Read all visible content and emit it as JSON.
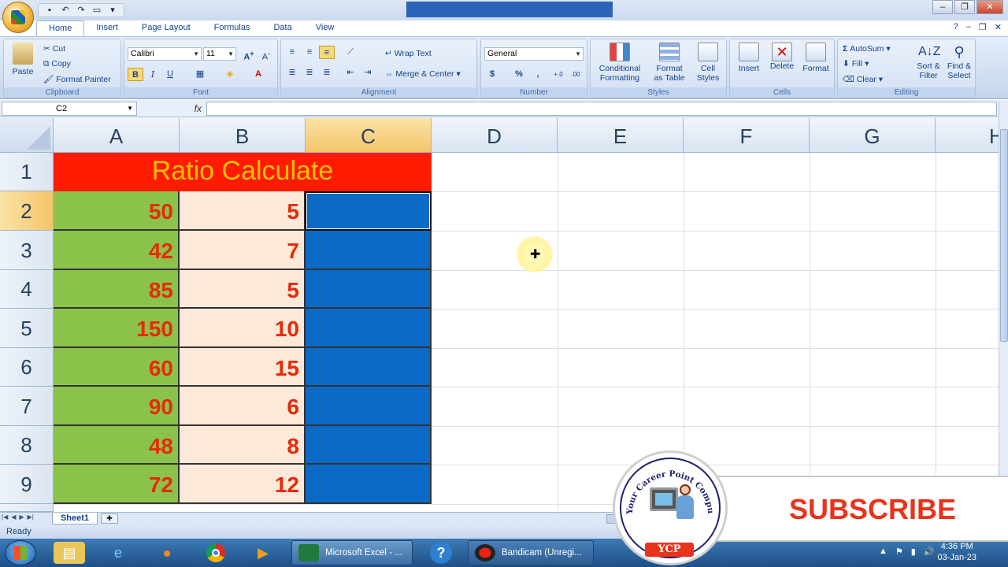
{
  "app": {
    "tabs": [
      "Home",
      "Insert",
      "Page Layout",
      "Formulas",
      "Data",
      "View"
    ],
    "active_tab": "Home"
  },
  "ribbon": {
    "clipboard": {
      "paste": "Paste",
      "cut": "Cut",
      "copy": "Copy",
      "format_painter": "Format Painter",
      "label": "Clipboard"
    },
    "font": {
      "name": "Calibri",
      "size": "11",
      "label": "Font",
      "bold": "B",
      "italic": "I",
      "underline": "U"
    },
    "alignment": {
      "wrap_text": "Wrap Text",
      "merge_center": "Merge & Center",
      "label": "Alignment"
    },
    "number": {
      "format": "General",
      "currency": "$",
      "percent": "%",
      "comma": ",",
      "inc_decimal": "+.0",
      "dec_decimal": ".00",
      "label": "Number"
    },
    "styles": {
      "conditional_1": "Conditional",
      "conditional_2": "Formatting",
      "format_table_1": "Format",
      "format_table_2": "as Table",
      "cell_styles_1": "Cell",
      "cell_styles_2": "Styles",
      "label": "Styles"
    },
    "cells": {
      "insert": "Insert",
      "delete": "Delete",
      "format": "Format",
      "label": "Cells"
    },
    "editing": {
      "autosum": "AutoSum",
      "fill": "Fill",
      "clear": "Clear",
      "sort_1": "Sort &",
      "sort_2": "Filter",
      "find_1": "Find &",
      "find_2": "Select",
      "label": "Editing"
    }
  },
  "formula_bar": {
    "name_box": "C2",
    "fx": "fx",
    "value": ""
  },
  "sheet": {
    "columns": [
      "A",
      "B",
      "C",
      "D",
      "E",
      "F",
      "G",
      "H"
    ],
    "rows": [
      "1",
      "2",
      "3",
      "4",
      "5",
      "6",
      "7",
      "8",
      "9"
    ],
    "title": "Ratio Calculate",
    "col_a": [
      "50",
      "42",
      "85",
      "150",
      "60",
      "90",
      "48",
      "72"
    ],
    "col_b": [
      "5",
      "7",
      "5",
      "10",
      "15",
      "6",
      "8",
      "12"
    ],
    "active_cell": "C2"
  },
  "sheet_tabs": {
    "sheet1": "Sheet1"
  },
  "status": {
    "ready": "Ready"
  },
  "overlay": {
    "subscribe": "SUBSCRIBE",
    "logo_text": "Your Career Point Computer Academy",
    "logo_abbr": "YCP"
  },
  "taskbar": {
    "excel_task": "Microsoft Excel - ...",
    "bandicam_task": "Bandicam (Unregi...",
    "time": "4:36 PM",
    "date": "03-Jan-23"
  },
  "colors": {
    "title_bg": "#fe1b00",
    "title_text": "#ffc000",
    "col_a_bg": "#8bc34a",
    "col_b_bg": "#fde9d9",
    "col_c_bg": "#0b6ac6",
    "value_text": "#e62b09",
    "header_active": "#f4c56a"
  }
}
